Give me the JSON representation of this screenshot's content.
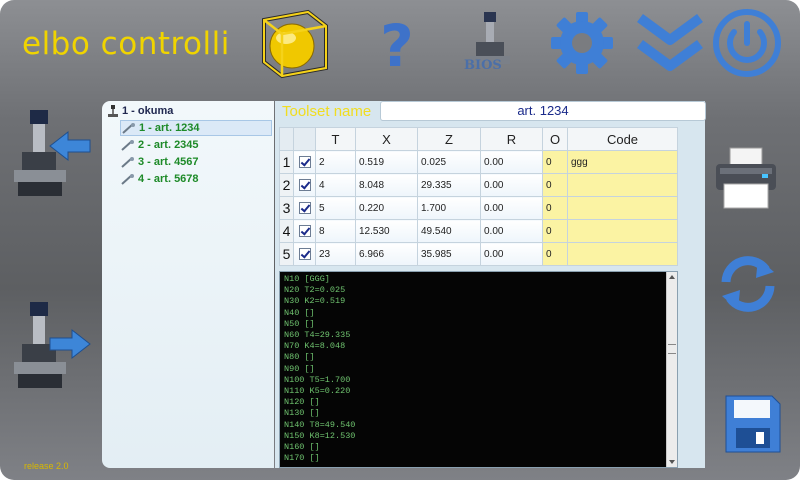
{
  "brand": {
    "name": "elbo controlli",
    "release": "release 2.0"
  },
  "toolbar": {
    "icons": [
      "tool-cube-icon",
      "help-icon",
      "bios-icon",
      "settings-icon",
      "collapse-icon",
      "power-icon"
    ],
    "bios_label": "BIOS",
    "help_glyph": "?"
  },
  "tree": {
    "root": "1 - okuma",
    "items": [
      {
        "label": "1 - art. 1234",
        "selected": true
      },
      {
        "label": "2 - art. 2345",
        "selected": false
      },
      {
        "label": "3 - art. 4567",
        "selected": false
      },
      {
        "label": "4 - art. 5678",
        "selected": false
      }
    ]
  },
  "toolset": {
    "label": "Toolset name",
    "value": "art. 1234"
  },
  "table": {
    "columns": [
      "",
      "",
      "T",
      "X",
      "Z",
      "R",
      "O",
      "Code"
    ],
    "rows": [
      {
        "n": "1",
        "T": "2",
        "X": "0.519",
        "Z": "0.025",
        "R": "0.00",
        "O": "0",
        "Code": "ggg"
      },
      {
        "n": "2",
        "T": "4",
        "X": "8.048",
        "Z": "29.335",
        "R": "0.00",
        "O": "0",
        "Code": ""
      },
      {
        "n": "3",
        "T": "5",
        "X": "0.220",
        "Z": "1.700",
        "R": "0.00",
        "O": "0",
        "Code": ""
      },
      {
        "n": "4",
        "T": "8",
        "X": "12.530",
        "Z": "49.540",
        "R": "0.00",
        "O": "0",
        "Code": ""
      },
      {
        "n": "5",
        "T": "23",
        "X": "6.966",
        "Z": "35.985",
        "R": "0.00",
        "O": "0",
        "Code": ""
      }
    ]
  },
  "console": {
    "lines": [
      "N10 [GGG]",
      "N20 T2=0.025",
      "N30 K2=0.519",
      "N40 []",
      "N50 []",
      "N60 T4=29.335",
      "N70 K4=8.048",
      "N80 []",
      "N90 []",
      "N100 T5=1.700",
      "N110 K5=0.220",
      "N120 []",
      "N130 []",
      "N140 T8=49.540",
      "N150 K8=12.530",
      "N160 []",
      "N170 []"
    ]
  },
  "colors": {
    "brand_yellow": "#f0d400",
    "icon_blue": "#3f7fd6",
    "code_yellow": "#fbf3a3",
    "console_green": "#6fc36f"
  }
}
